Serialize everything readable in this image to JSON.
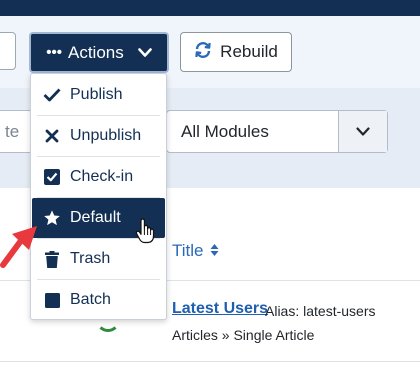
{
  "toolbar": {
    "actions_label": "Actions",
    "rebuild_label": "Rebuild"
  },
  "filters": {
    "left_partial_text": "te",
    "module_select_value": "All Modules"
  },
  "actions_menu": {
    "items": [
      {
        "label": "Publish",
        "icon": "check-icon"
      },
      {
        "label": "Unpublish",
        "icon": "times-icon"
      },
      {
        "label": "Check-in",
        "icon": "checkbox-icon"
      },
      {
        "label": "Default",
        "icon": "star-icon",
        "active": true
      },
      {
        "label": "Trash",
        "icon": "trash-icon"
      },
      {
        "label": "Batch",
        "icon": "square-icon"
      }
    ]
  },
  "table": {
    "title_header": "Title",
    "rows": [
      {
        "title": "Latest Users",
        "alias": "Alias: latest-users",
        "type": "Articles » Single Article"
      }
    ]
  },
  "colors": {
    "navy": "#132f53",
    "link": "#1f5fb0",
    "annotation_arrow": "#e8393f"
  }
}
